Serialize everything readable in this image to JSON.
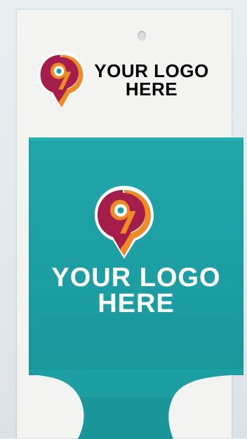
{
  "card": {
    "logo_line1": "YOUR LOGO",
    "logo_line2": "HERE"
  },
  "sleeve": {
    "logo_line1": "YOUR LOGO",
    "logo_line2": "HERE"
  },
  "colors": {
    "sleeve": "#1c9ea3",
    "logo_maroon": "#a51d4a",
    "logo_orange": "#f08a24",
    "card": "#f3f3f1"
  },
  "icons": [
    "map-pin-logo-icon"
  ]
}
